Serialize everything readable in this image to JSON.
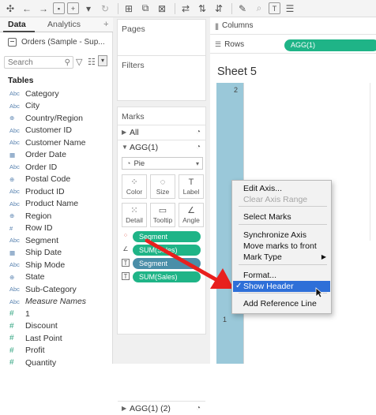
{
  "toolbar": {
    "icons": [
      "tableau-logo-icon",
      "back-icon",
      "forward-icon",
      "save-icon",
      "new-datasource-icon",
      "pause-icon",
      "refresh-icon",
      "new-worksheet-icon",
      "duplicate-icon",
      "clear-icon",
      "swap-icon",
      "sort-ascending-icon",
      "sort-descending-icon",
      "highlight-icon",
      "group-icon",
      "label-icon",
      "fix-axes-icon"
    ]
  },
  "data_pane": {
    "tabs": [
      {
        "label": "Data"
      },
      {
        "label": "Analytics"
      }
    ],
    "tab_menu_icon": "plus-menu-icon",
    "datasource": "Orders (Sample - Sup...",
    "search_placeholder": "Search",
    "tables_heading": "Tables",
    "fields": [
      {
        "icon": "Abc",
        "label": "Category",
        "kind": "dimension"
      },
      {
        "icon": "Abc",
        "label": "City",
        "kind": "dimension"
      },
      {
        "icon": "⊕",
        "label": "Country/Region",
        "kind": "geo"
      },
      {
        "icon": "Abc",
        "label": "Customer ID",
        "kind": "dimension"
      },
      {
        "icon": "Abc",
        "label": "Customer Name",
        "kind": "dimension"
      },
      {
        "icon": "▦",
        "label": "Order Date",
        "kind": "date"
      },
      {
        "icon": "Abc",
        "label": "Order ID",
        "kind": "dimension"
      },
      {
        "icon": "⊕",
        "label": "Postal Code",
        "kind": "geo"
      },
      {
        "icon": "Abc",
        "label": "Product ID",
        "kind": "dimension"
      },
      {
        "icon": "Abc",
        "label": "Product Name",
        "kind": "dimension"
      },
      {
        "icon": "⊕",
        "label": "Region",
        "kind": "geo"
      },
      {
        "icon": "#",
        "label": "Row ID",
        "kind": "dimension"
      },
      {
        "icon": "Abc",
        "label": "Segment",
        "kind": "dimension"
      },
      {
        "icon": "▦",
        "label": "Ship Date",
        "kind": "date"
      },
      {
        "icon": "Abc",
        "label": "Ship Mode",
        "kind": "dimension"
      },
      {
        "icon": "⊕",
        "label": "State",
        "kind": "geo"
      },
      {
        "icon": "Abc",
        "label": "Sub-Category",
        "kind": "dimension"
      },
      {
        "icon": "Abc",
        "label": "Measure Names",
        "kind": "italic"
      },
      {
        "icon": "#",
        "label": "1",
        "kind": "measure"
      },
      {
        "icon": "#",
        "label": "Discount",
        "kind": "measure"
      },
      {
        "icon": "#",
        "label": "Last Point",
        "kind": "measure"
      },
      {
        "icon": "#",
        "label": "Profit",
        "kind": "measure"
      },
      {
        "icon": "#",
        "label": "Quantity",
        "kind": "measure"
      }
    ]
  },
  "cards": {
    "pages": "Pages",
    "filters": "Filters",
    "marks": {
      "title": "Marks",
      "all_label": "All",
      "agg1_label": "AGG(1)",
      "mark_type": "Pie",
      "encodings": [
        {
          "label": "Color",
          "icon": "color-icon"
        },
        {
          "label": "Size",
          "icon": "size-icon"
        },
        {
          "label": "Label",
          "icon": "label-icon"
        },
        {
          "label": "Detail",
          "icon": "detail-icon"
        },
        {
          "label": "Tooltip",
          "icon": "tooltip-icon"
        },
        {
          "label": "Angle",
          "icon": "angle-icon"
        }
      ],
      "pills": [
        {
          "icon": "color-dots-icon",
          "text": "Segment",
          "color": "#1fb487"
        },
        {
          "icon": "angle-icon",
          "text": "SUM(Sales)",
          "color": "#1fb487"
        },
        {
          "icon": "label-icon",
          "text": "Segment",
          "color": "#4a8ea8"
        },
        {
          "icon": "label-icon",
          "text": "SUM(Sales)",
          "color": "#1fb487"
        }
      ],
      "agg2_label": "AGG(1) (2)"
    }
  },
  "shelves": {
    "columns_label": "Columns",
    "rows_label": "Rows",
    "rows_pill": "AGG(1)"
  },
  "sheet": {
    "title": "Sheet 5",
    "axis_ticks": [
      "2",
      "1"
    ],
    "axis_color": "#9ac8d9"
  },
  "context_menu": {
    "items": [
      {
        "label": "Edit Axis...",
        "enabled": true
      },
      {
        "label": "Clear Axis Range",
        "enabled": false
      },
      {
        "label": "Select Marks",
        "enabled": true
      },
      {
        "label": "Synchronize Axis",
        "enabled": true
      },
      {
        "label": "Move marks to front",
        "enabled": true
      },
      {
        "label": "Mark Type",
        "enabled": true,
        "submenu": true
      },
      {
        "label": "Format...",
        "enabled": true
      },
      {
        "label": "Show Header",
        "enabled": true,
        "checked": true,
        "highlighted": true
      },
      {
        "label": "Add Reference Line",
        "enabled": true
      }
    ],
    "highlight_color": "#2e6fd8"
  },
  "annotation": {
    "arrow_color": "#e8201e"
  }
}
